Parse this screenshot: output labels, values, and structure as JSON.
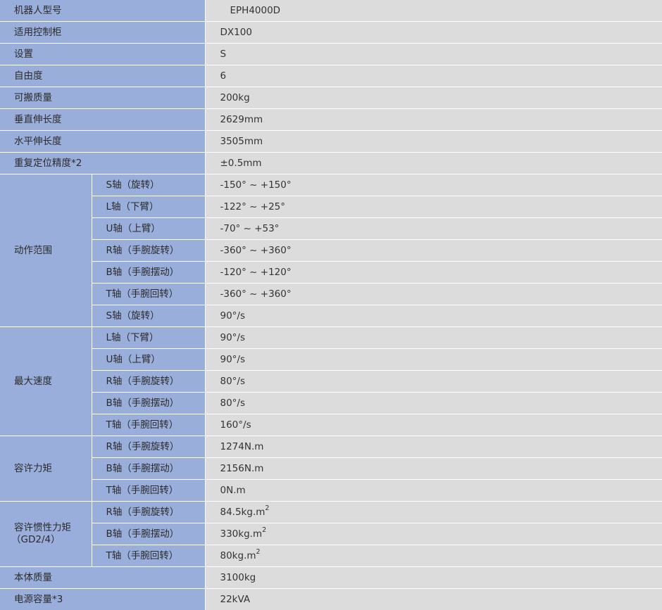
{
  "spec_table": {
    "model": {
      "label": "机器人型号",
      "value": "EPH4000D"
    },
    "controller": {
      "label": "适用控制柜",
      "value": "DX100"
    },
    "setting": {
      "label": "设置",
      "value": "S"
    },
    "dof": {
      "label": "自由度",
      "value": "6"
    },
    "payload": {
      "label": "可搬质量",
      "value": "200kg"
    },
    "vertical_reach": {
      "label": "垂直伸长度",
      "value": "2629mm"
    },
    "horizontal_reach": {
      "label": "水平伸长度",
      "value": "3505mm"
    },
    "repeatability": {
      "label": "重复定位精度*2",
      "value": "±0.5mm"
    },
    "motion_range": {
      "label": "动作范围",
      "rows": [
        {
          "axis": "S轴（旋转）",
          "value": "-150° ~ +150°"
        },
        {
          "axis": "L轴（下臂）",
          "value": "-122° ~ +25°"
        },
        {
          "axis": "U轴（上臂）",
          "value": "-70° ~ +53°"
        },
        {
          "axis": "R轴（手腕旋转）",
          "value": "-360° ~ +360°"
        },
        {
          "axis": "B轴（手腕摆动）",
          "value": "-120° ~ +120°"
        },
        {
          "axis": "T轴（手腕回转）",
          "value": "-360° ~ +360°"
        },
        {
          "axis": "S轴（旋转）",
          "value": "90°/s"
        }
      ]
    },
    "max_speed": {
      "label": "最大速度",
      "rows": [
        {
          "axis": "L轴（下臂）",
          "value": "90°/s"
        },
        {
          "axis": "U轴（上臂）",
          "value": "90°/s"
        },
        {
          "axis": "R轴（手腕旋转）",
          "value": "80°/s"
        },
        {
          "axis": "B轴（手腕摆动）",
          "value": "80°/s"
        },
        {
          "axis": "T轴（手腕回转）",
          "value": "160°/s"
        }
      ]
    },
    "allowable_torque": {
      "label": "容许力矩",
      "rows": [
        {
          "axis": "R轴（手腕旋转）",
          "value": "1274N.m"
        },
        {
          "axis": "B轴（手腕摆动）",
          "value": "2156N.m"
        },
        {
          "axis": "T轴（手腕回转）",
          "value": "0N.m"
        }
      ]
    },
    "allowable_inertia": {
      "label_line1": "容许惯性力矩",
      "label_line2": "（GD2/4）",
      "superscript": "2",
      "rows": [
        {
          "axis": "R轴（手腕旋转）",
          "value": "84.5kg.m"
        },
        {
          "axis": "B轴（手腕摆动）",
          "value": "330kg.m"
        },
        {
          "axis": "T轴（手腕回转）",
          "value": "80kg.m"
        }
      ]
    },
    "body_mass": {
      "label": "本体质量",
      "value": "3100kg"
    },
    "power_capacity": {
      "label": "电源容量*3",
      "value": "22kVA"
    }
  }
}
